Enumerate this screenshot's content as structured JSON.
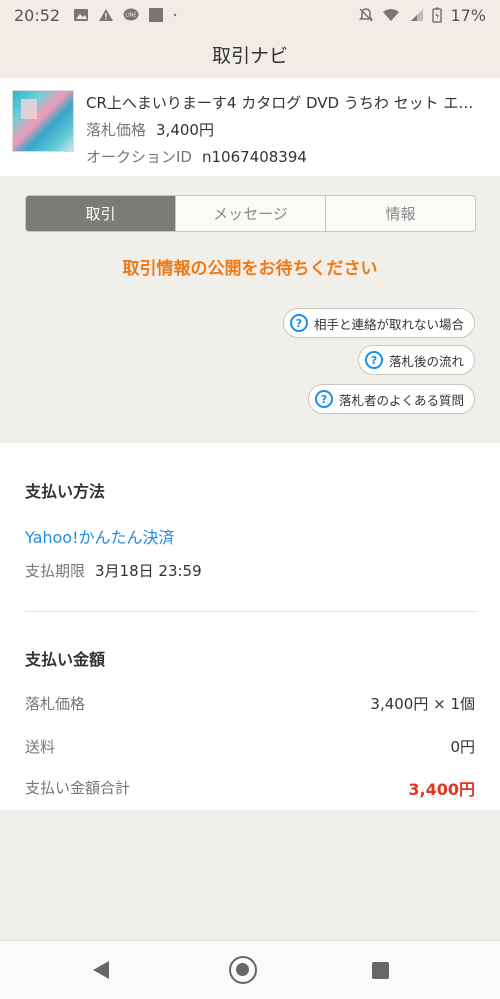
{
  "status_bar": {
    "time": "20:52",
    "battery": "17%",
    "left_icons": [
      "image-icon",
      "warning-icon",
      "line-icon",
      "square-icon",
      "dot-icon"
    ],
    "right_icons": [
      "mute-icon",
      "wifi-icon",
      "signal-icon",
      "battery-icon"
    ]
  },
  "header": {
    "title": "取引ナビ"
  },
  "item": {
    "title": "CR上へまいりまーす4 カタログ DVD うちわ セット エース…",
    "price_label": "落札価格",
    "price_value": "3,400円",
    "auction_label": "オークションID",
    "auction_value": "n1067408394"
  },
  "tabs": [
    {
      "label": "取引",
      "active": true
    },
    {
      "label": "メッセージ",
      "active": false
    },
    {
      "label": "情報",
      "active": false
    }
  ],
  "notice": "取引情報の公開をお待ちください",
  "help_links": [
    "相手と連絡が取れない場合",
    "落札後の流れ",
    "落札者のよくある質問"
  ],
  "payment_method": {
    "title": "支払い方法",
    "method": "Yahoo!かんたん決済",
    "deadline_label": "支払期限",
    "deadline_value": "3月18日 23:59"
  },
  "payment_amount": {
    "title": "支払い金額",
    "rows": [
      {
        "label": "落札価格",
        "value": "3,400円 × 1個"
      },
      {
        "label": "送料",
        "value": "0円"
      },
      {
        "label": "支払い金額合計",
        "value": "3,400円"
      }
    ]
  },
  "colors": {
    "accent_orange": "#f07a1a",
    "link_blue": "#1a8ee8",
    "total_red": "#e8331f"
  }
}
